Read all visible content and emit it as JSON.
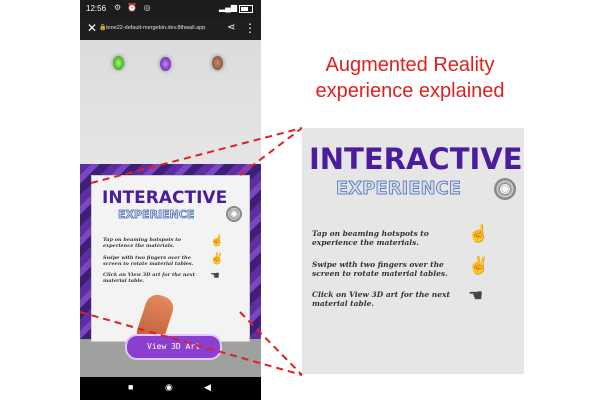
{
  "statusbar": {
    "time": "12:56",
    "icons": "⚙ ⏰ ◎"
  },
  "browser": {
    "url": "tone22-default-mergebin.dev.8thwall.app",
    "close_icon": "close-icon",
    "share_icon": "share-icon",
    "menu_icon": "more-vert-icon"
  },
  "hotspots": [
    "hotspot-green",
    "hotspot-purple",
    "hotspot-red"
  ],
  "card": {
    "title": "INTERACTIVE",
    "subtitle": "EXPERIENCE",
    "steps": [
      {
        "text": "Tap on beaming hotspots to experience the materials.",
        "icon": "tap-hand-icon"
      },
      {
        "text": "Swipe with two fingers over the screen to rotate material tables.",
        "icon": "two-finger-swipe-icon"
      },
      {
        "text": "Click on View 3D art for the next material table.",
        "icon": "click-hand-icon"
      }
    ]
  },
  "view3d_button": "View 3D Art",
  "caption": {
    "line1": "Augmented Reality",
    "line2": "experience explained"
  },
  "colors": {
    "accent_red": "#e02020",
    "title_purple": "#4b1d9e",
    "button_purple": "#8c3fcf"
  }
}
